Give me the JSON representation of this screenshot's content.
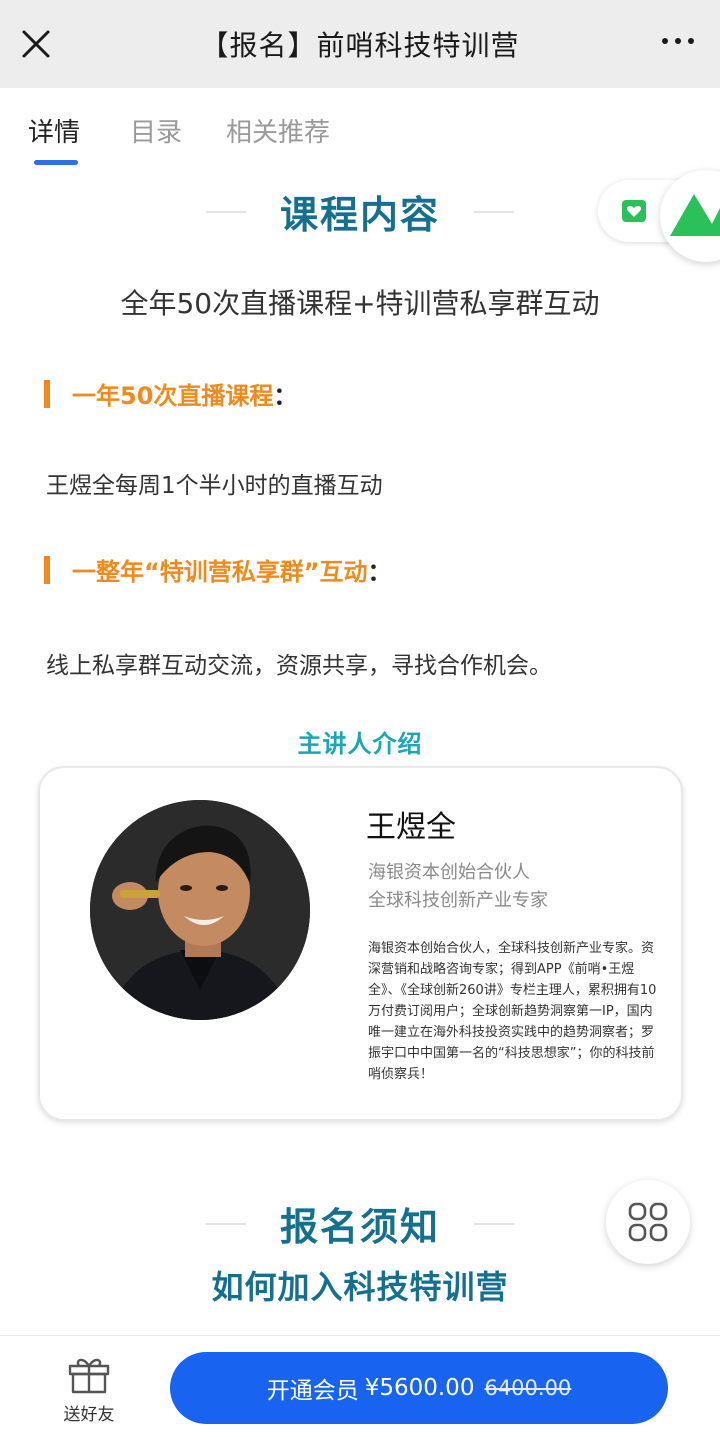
{
  "header": {
    "title": "【报名】前哨科技特训营"
  },
  "tabs": [
    {
      "label": "详情"
    },
    {
      "label": "目录"
    },
    {
      "label": "相关推荐"
    }
  ],
  "course": {
    "heading": "课程内容",
    "subtitle": "全年50次直播课程+特训营私享群互动",
    "point1_title": "一年50次直播课程",
    "point1_text": "王煜全每周1个半小时的直播互动",
    "point2_title": "一整年“特训营私享群”互动",
    "point2_text": "线上私享群互动交流，资源共享，寻找合作机会。",
    "colon": "："
  },
  "speaker": {
    "heading": "主讲人介绍",
    "name": "王煜全",
    "role1": "海银资本创始合伙人",
    "role2": "全球科技创新产业专家",
    "bio": "海银资本创始合伙人，全球科技创新产业专家。资深营销和战略咨询专家；得到APP《前哨•王煜全》、《全球创新260讲》专栏主理人，累积拥有10万付费订阅用户；全球创新趋势洞察第一IP，国内唯一建立在海外科技投资实践中的趋势洞察者；罗振宇口中中国第一名的“科技思想家”；你的科技前哨侦察兵！"
  },
  "signup": {
    "heading": "报名须知",
    "subheading": "如何加入科技特训营"
  },
  "bottom": {
    "gift_label": "送好友",
    "buy_label": "开通会员",
    "price": "¥5600.00",
    "original_price": "6400.00"
  },
  "colors": {
    "accent_blue": "#1864f0",
    "teal_heading": "#15708f",
    "orange": "#f08a1c",
    "teal_light": "#1aa6b2"
  }
}
